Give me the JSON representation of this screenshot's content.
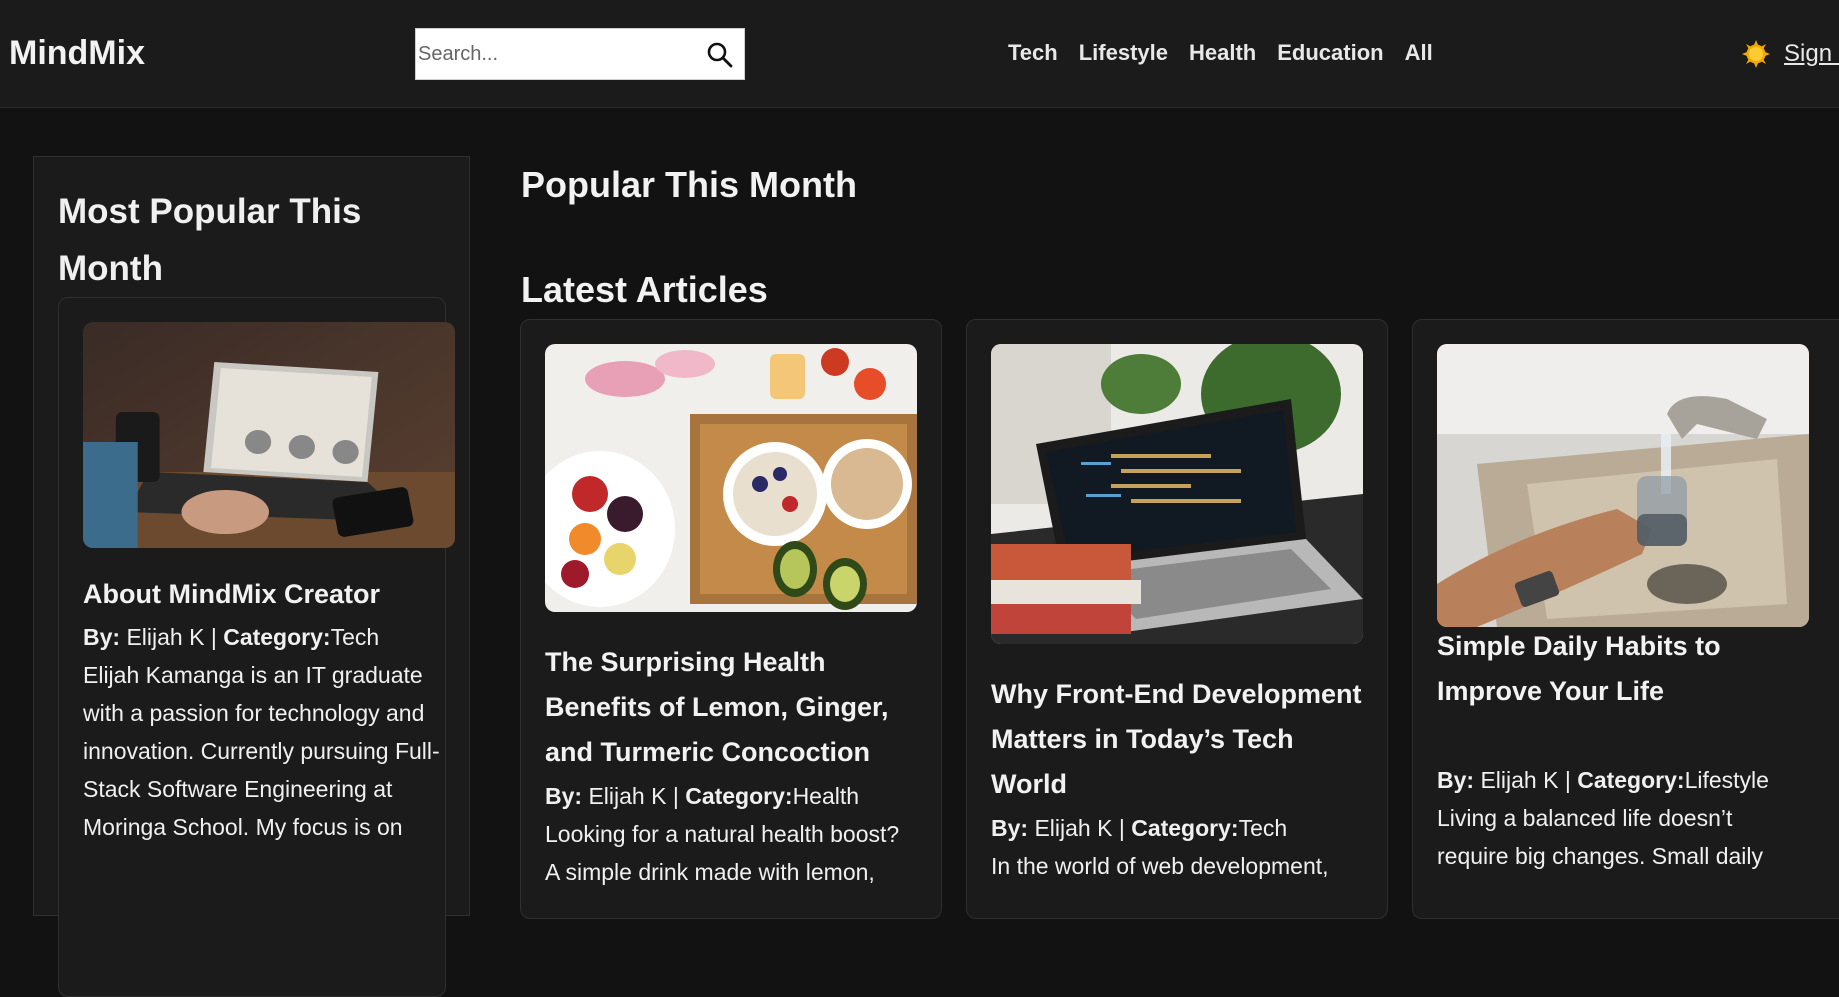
{
  "header": {
    "logo": "MindMix",
    "search_placeholder": "Search...",
    "nav": [
      "Tech",
      "Lifestyle",
      "Health",
      "Education",
      "All"
    ],
    "signin": "Sign In"
  },
  "sidebar": {
    "title": "Most Popular This Month",
    "card": {
      "title": "About MindMix Creator",
      "by_label": "By:",
      "author": " Elijah K | ",
      "category_label": "Category:",
      "category": "Tech",
      "excerpt": "Elijah Kamanga is an IT graduate with a passion for technology and innovation. Currently pursuing Full-Stack Software Engineering at Moringa School. My focus is on"
    }
  },
  "main": {
    "popular_title": "Popular This Month",
    "latest_title": "Latest Articles",
    "articles": [
      {
        "title": "The Surprising Health Benefits of Lemon, Ginger, and Turmeric Concoction",
        "by_label": "By:",
        "author": " Elijah K | ",
        "category_label": "Category:",
        "category": "Health",
        "excerpt": "Looking for a natural health boost? A simple drink made with lemon,"
      },
      {
        "title": "Why Front-End Development Matters in Today’s Tech World",
        "by_label": "By:",
        "author": " Elijah K | ",
        "category_label": "Category:",
        "category": "Tech",
        "excerpt": "In the world of web development,"
      },
      {
        "title": "Simple Daily Habits to Improve Your Life",
        "by_label": "By:",
        "author": " Elijah K | ",
        "category_label": "Category:",
        "category": "Lifestyle",
        "excerpt": "Living a balanced life doesn’t require big changes. Small daily"
      }
    ]
  },
  "colors": {
    "background": "#121212",
    "header_bg": "#1b1b1b",
    "card_bg": "#1b1b1b",
    "border": "#2f2f2f",
    "theme_toggle": "#f2a900"
  },
  "icons": [
    "search-icon",
    "sun-icon"
  ]
}
